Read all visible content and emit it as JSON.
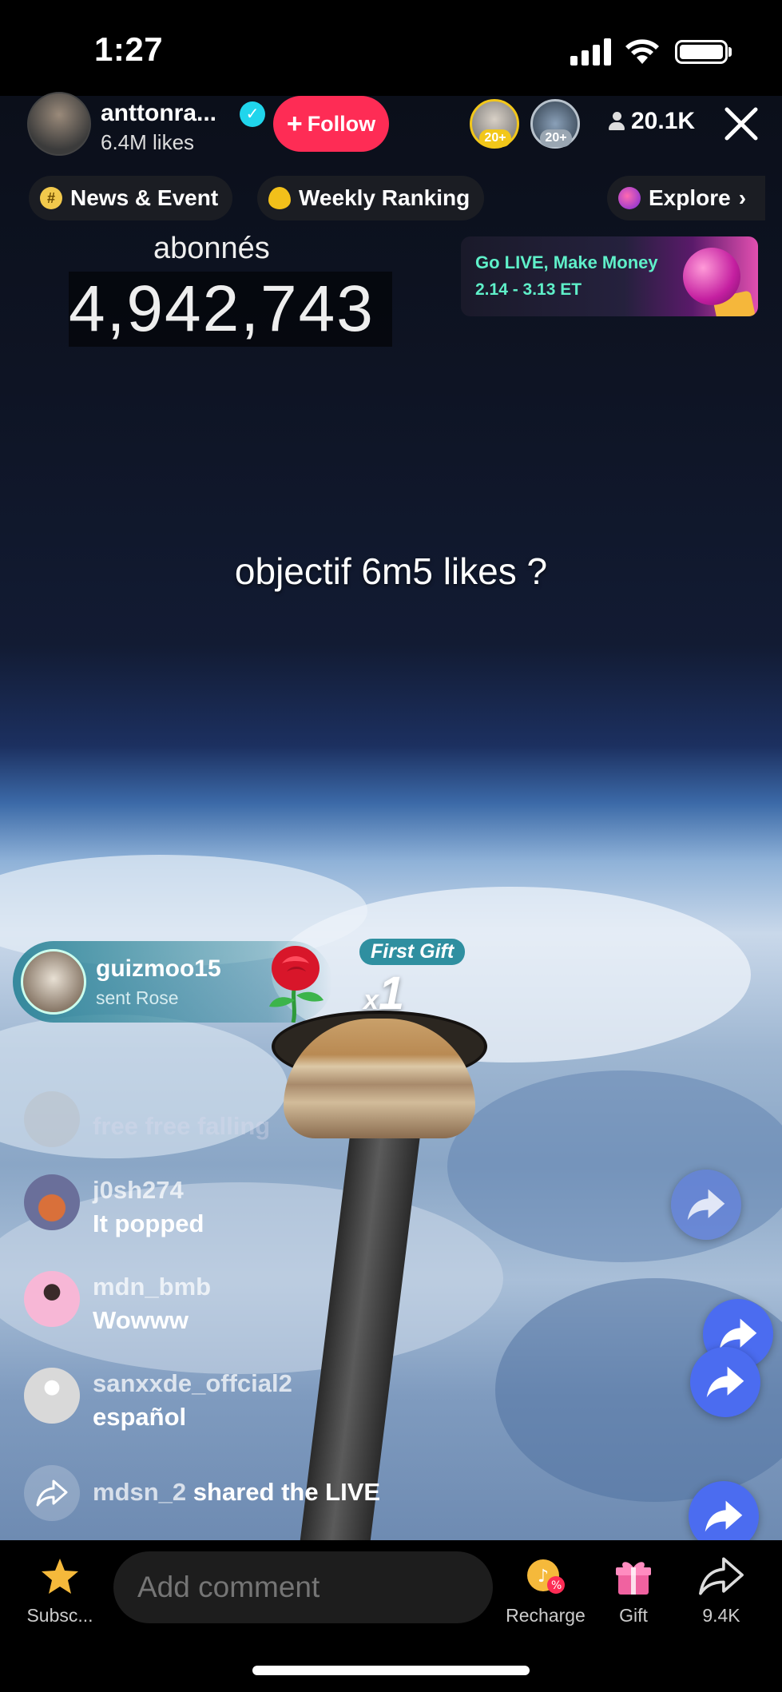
{
  "status": {
    "time": "1:27"
  },
  "host": {
    "name": "anttonra...",
    "likes": "6.4M likes",
    "follow_label": "Follow",
    "viewers": "20.1K",
    "top_viewers": [
      {
        "rank": "20+"
      },
      {
        "rank": "20+"
      }
    ]
  },
  "pills": {
    "news": "News & Event",
    "weekly": "Weekly Ranking",
    "explore": "Explore"
  },
  "overlay": {
    "abonnes_label": "abonnés",
    "abonnes_count": "4,942,743",
    "objectif": "objectif 6m5 likes ?"
  },
  "golive": {
    "title": "Go LIVE, Make Money",
    "dates": "2.14 - 3.13 ET"
  },
  "gift": {
    "user": "guizmoo15",
    "action": "sent Rose",
    "badge": "First Gift",
    "count_prefix": "x",
    "count": "1"
  },
  "comments": [
    {
      "user": "",
      "text": "free free falling",
      "faded": true
    },
    {
      "user": "j0sh274",
      "text": "It popped"
    },
    {
      "user": "mdn_bmb",
      "text": "Wowww"
    },
    {
      "user": "sanxxde_offcial2",
      "text": "español"
    }
  ],
  "share_event": {
    "user": "mdsn_2",
    "text": "shared the LIVE"
  },
  "bottom": {
    "subscribe": "Subsc...",
    "comment_placeholder": "Add comment",
    "recharge": "Recharge",
    "gift": "Gift",
    "share_count": "9.4K"
  },
  "colors": {
    "follow": "#fe2c55",
    "verified": "#20d5ec",
    "share_bubble": "#4b6cf0",
    "golive_text": "#5ff0c9"
  }
}
